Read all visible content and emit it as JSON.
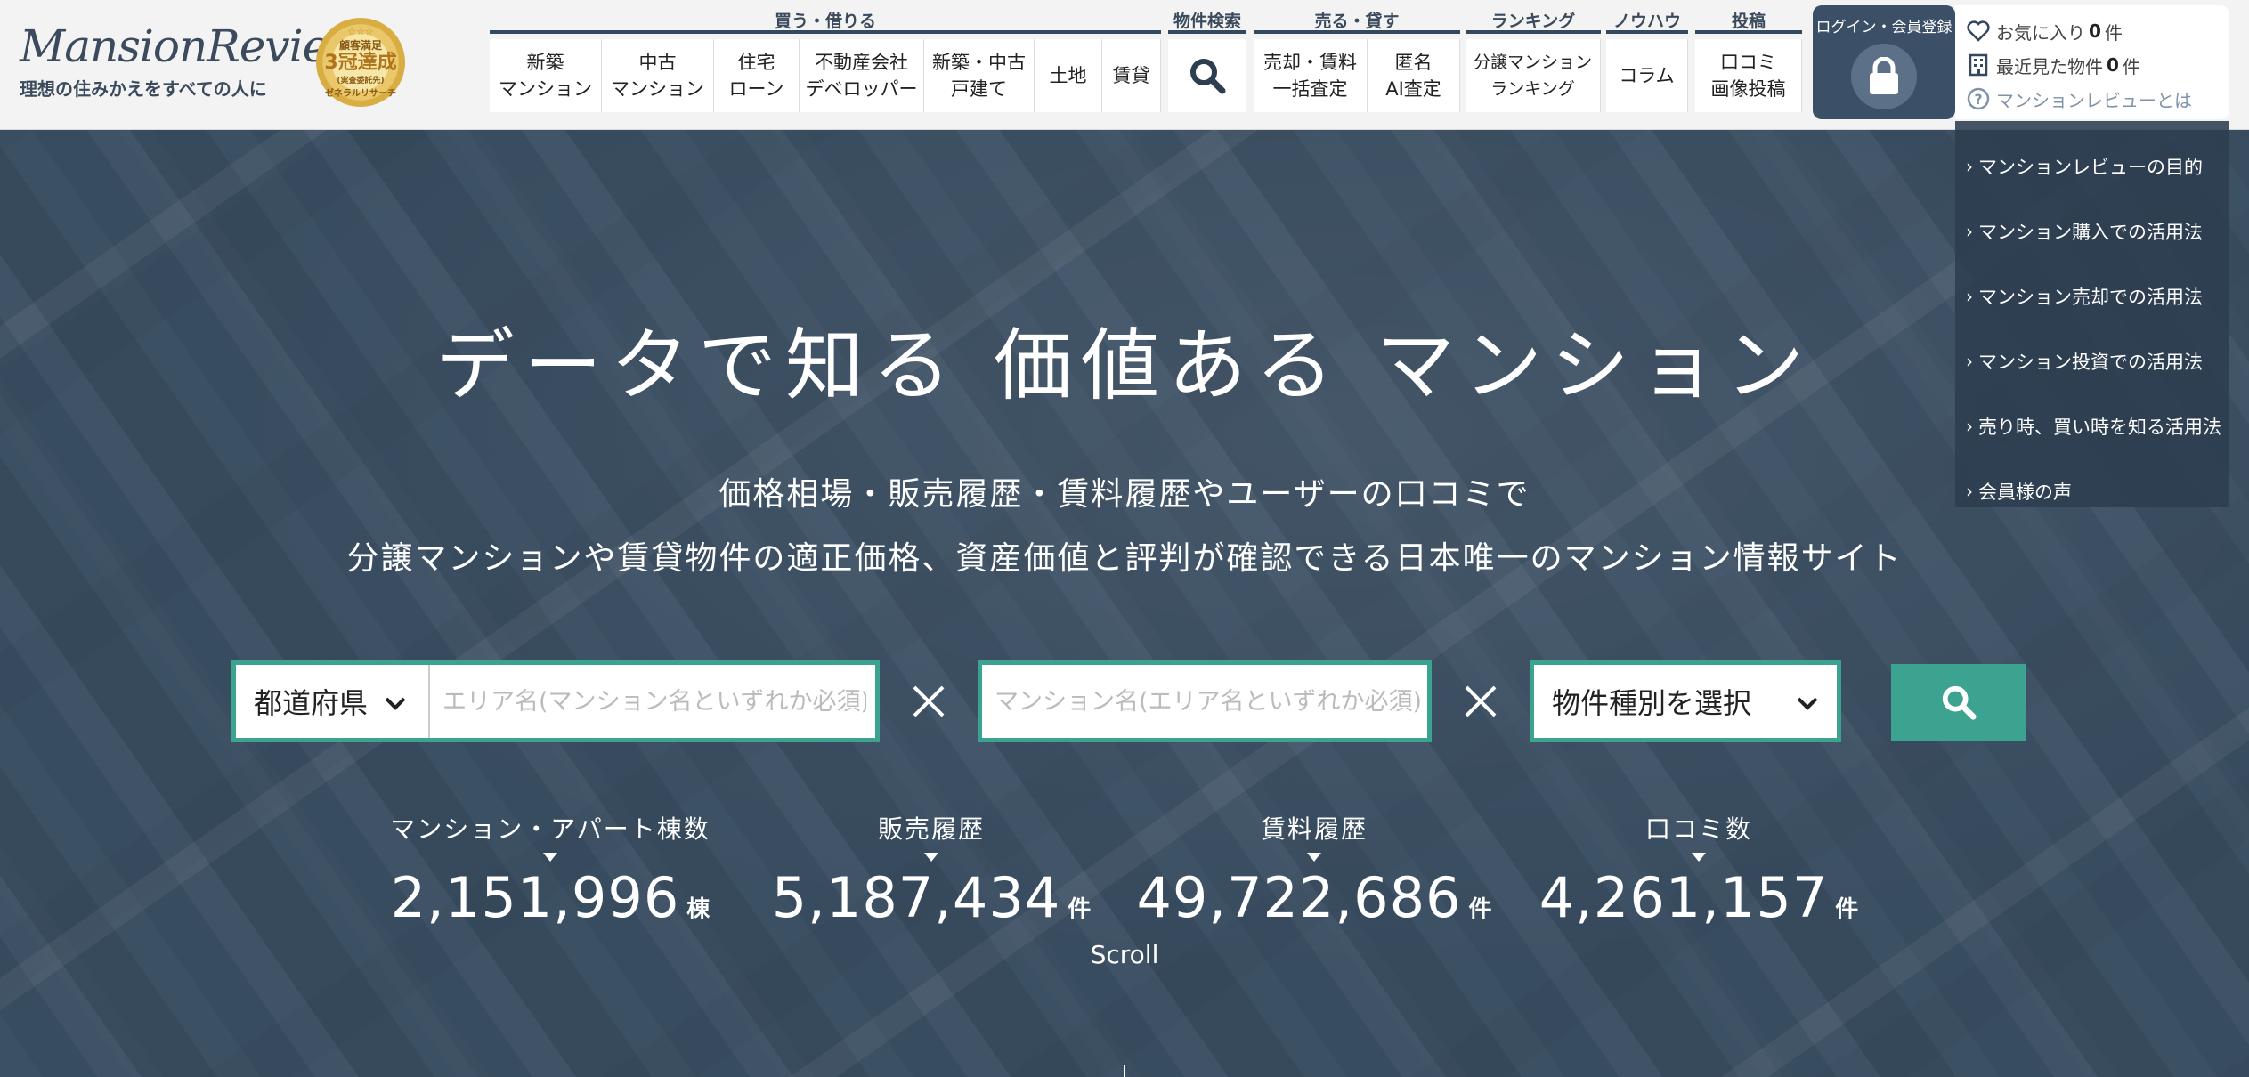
{
  "brand": {
    "logo_text": "MansionReview",
    "tagline": "理想の住みかえをすべての人に",
    "badge": {
      "stars": "☆☆☆",
      "line1": "顧客満足",
      "line2": "3冠達成",
      "line3": "(実査委託先)",
      "line4": "ゼネラルリサーチ"
    }
  },
  "nav": {
    "buy": {
      "label": "買う・借りる",
      "items": [
        "新築\nマンション",
        "中古\nマンション",
        "住宅\nローン",
        "不動産会社\nデベロッパー",
        "新築・中古\n戸建て",
        "土地",
        "賃貸"
      ]
    },
    "search": {
      "label": "物件検索"
    },
    "sell": {
      "label": "売る・貸す",
      "items": [
        "売却・賃料\n一括査定",
        "匿名\nAI査定"
      ]
    },
    "ranking": {
      "label": "ランキング",
      "items": [
        "分譲マンション\nランキング"
      ]
    },
    "knowhow": {
      "label": "ノウハウ",
      "items": [
        "コラム"
      ]
    },
    "post": {
      "label": "投稿",
      "items": [
        "口コミ\n画像投稿"
      ]
    }
  },
  "account": {
    "login_label": "ログイン・会員登録",
    "favorites_label": "お気に入り",
    "favorites_count": "0",
    "recent_label": "最近見た物件",
    "recent_count": "0",
    "count_unit": "件",
    "about_label": "マンションレビューとは"
  },
  "about_menu": [
    "マンションレビューの目的",
    "マンション購入での活用法",
    "マンション売却での活用法",
    "マンション投資での活用法",
    "売り時、買い時を知る活用法",
    "会員様の声"
  ],
  "hero": {
    "headline": "データで知る 価値ある マンション",
    "sub1": "価格相場・販売履歴・賃料履歴やユーザーの口コミで",
    "sub2": "分譲マンションや賃貸物件の適正価格、資産価値と評判が確認できる日本唯一のマンション情報サイト"
  },
  "search": {
    "prefecture_label": "都道府県",
    "area_placeholder": "エリア名(マンション名といずれか必須)",
    "mansion_placeholder": "マンション名(エリア名といずれか必須)",
    "type_label": "物件種別を選択"
  },
  "stats": [
    {
      "label": "マンション・アパート棟数",
      "value": "2,151,996",
      "unit": "棟"
    },
    {
      "label": "販売履歴",
      "value": "5,187,434",
      "unit": "件"
    },
    {
      "label": "賃料履歴",
      "value": "49,722,686",
      "unit": "件"
    },
    {
      "label": "口コミ数",
      "value": "4,261,157",
      "unit": "件"
    }
  ],
  "scroll_label": "Scroll",
  "colors": {
    "accent": "#3da391",
    "navy": "#3b4f66",
    "header_bg": "#f3f3f3"
  }
}
